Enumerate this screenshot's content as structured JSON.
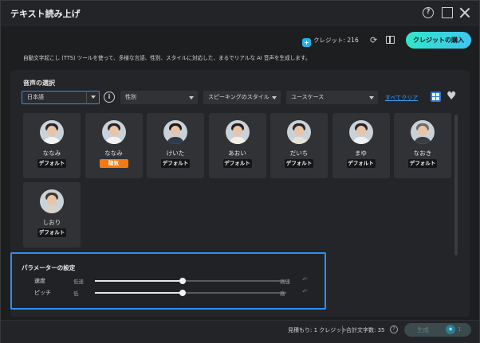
{
  "window": {
    "title": "テキスト読み上げ"
  },
  "header": {
    "credits_label": "クレジット: 216",
    "buy_button": "クレジットの購入"
  },
  "description": "自動文字起こし (TTS) ツールを使って、多様な言語、性別、スタイルに対応した、まるでリアルな AI 音声を生成します。",
  "voice_section": {
    "title": "音声の選択",
    "filters": {
      "language": "日本語",
      "gender": "性別",
      "speaking_style": "スピーキングのスタイル",
      "use_case": "ユースケース"
    },
    "clear_all": "すべてクリア"
  },
  "voices": [
    {
      "name": "ななみ",
      "tag": "デフォルト",
      "popular": false
    },
    {
      "name": "ななみ",
      "tag": "陽気",
      "popular": true
    },
    {
      "name": "けいた",
      "tag": "デフォルト",
      "popular": false
    },
    {
      "name": "あおい",
      "tag": "デフォルト",
      "popular": false
    },
    {
      "name": "だいち",
      "tag": "デフォルト",
      "popular": false
    },
    {
      "name": "まゆ",
      "tag": "デフォルト",
      "popular": false
    },
    {
      "name": "なおき",
      "tag": "デフォルト",
      "popular": false
    },
    {
      "name": "しおり",
      "tag": "デフォルト",
      "popular": false
    }
  ],
  "parameters": {
    "title": "パラメーターの設定",
    "speed": {
      "label": "速度",
      "low": "低速",
      "high": "高速",
      "value": 0.46
    },
    "pitch": {
      "label": "ピッチ",
      "low": "低",
      "high": "高",
      "value": 0.46
    }
  },
  "footer": {
    "estimate": "見積もり: 1 クレジット",
    "total_chars": "合計文字数: 35",
    "generate_button": "生成",
    "generate_count": "1"
  },
  "colors": {
    "accent": "#2f8ff5",
    "buy_gradient_start": "#33e6c8",
    "buy_gradient_end": "#3ec6f0",
    "popular_tag": "#f37a12"
  }
}
